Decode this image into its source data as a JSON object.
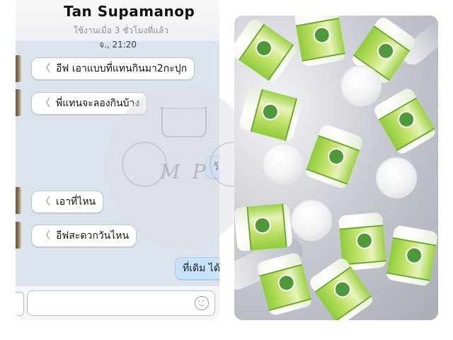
{
  "chat": {
    "contact_name": "Tan Supamanop",
    "last_seen": "ใช้งานเมื่อ 3 ชั่วโมงที่แล้ว",
    "timestamp": "จ., 21:20",
    "incoming": [
      {
        "text": "อีฟ เอาแบบที่แทนกินมา2กะปุก"
      },
      {
        "text": "พี่แทนจะลองกินบ้าง"
      },
      {
        "text": "เอาที่ไหน"
      },
      {
        "text": "อีฟสะดวกวันไหน"
      }
    ],
    "outgoing": [
      {
        "text": "ว้"
      },
      {
        "text": "ที่เดิม ได้"
      }
    ],
    "composer": {
      "placeholder": ""
    },
    "icons": {
      "emoji": "smiley-icon",
      "bubble_tail": "chevron-left-icon"
    }
  },
  "watermark": {
    "text": "M P"
  },
  "colors": {
    "chat_bg": "#dde3ec",
    "outgoing_bubble": "#c7e3fb",
    "incoming_bubble": "#ffffff",
    "label_green": "#8fcc3a"
  }
}
